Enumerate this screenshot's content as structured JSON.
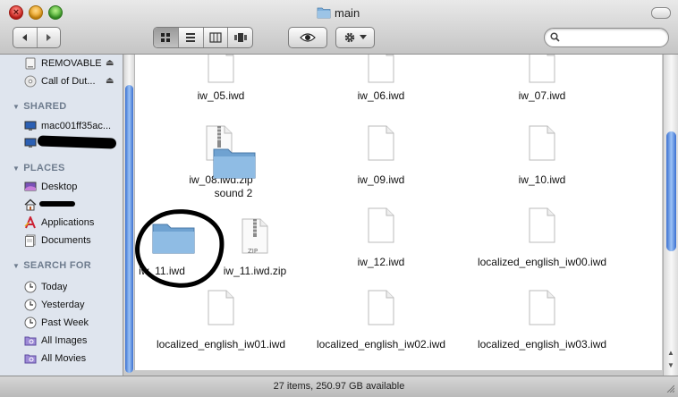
{
  "window": {
    "title": "main"
  },
  "toolbar": {
    "back_icon": "back-arrow-icon",
    "forward_icon": "forward-arrow-icon",
    "view_modes": [
      "icon-view-icon",
      "list-view-icon",
      "column-view-icon",
      "coverflow-view-icon"
    ],
    "active_view": "icon-view-icon",
    "quicklook_icon": "eye-icon",
    "action_icon": "gear-icon",
    "search": {
      "placeholder": "",
      "value": ""
    }
  },
  "sidebar": {
    "devices": [
      {
        "label": "REMOVABLE",
        "icon": "drive-icon",
        "eject": true
      },
      {
        "label": "Call of Dut...",
        "icon": "disc-icon",
        "eject": true
      }
    ],
    "shared_header": "SHARED",
    "shared": [
      {
        "label": "mac001ff35ac...",
        "icon": "monitor-icon"
      },
      {
        "label": "",
        "icon": "monitor-icon"
      }
    ],
    "places_header": "PLACES",
    "places": [
      {
        "label": "Desktop",
        "icon": "desktop-icon"
      },
      {
        "label": "",
        "icon": "home-icon"
      },
      {
        "label": "Applications",
        "icon": "applications-icon"
      },
      {
        "label": "Documents",
        "icon": "documents-icon"
      }
    ],
    "search_header": "SEARCH FOR",
    "search_for": [
      {
        "label": "Today",
        "icon": "clock-icon"
      },
      {
        "label": "Yesterday",
        "icon": "clock-icon"
      },
      {
        "label": "Past Week",
        "icon": "clock-icon"
      },
      {
        "label": "All Images",
        "icon": "smart-folder-icon"
      },
      {
        "label": "All Movies",
        "icon": "smart-folder-icon"
      }
    ]
  },
  "files": [
    {
      "label": "iw_05.iwd",
      "type": "document"
    },
    {
      "label": "iw_06.iwd",
      "type": "document"
    },
    {
      "label": "iw_07.iwd",
      "type": "document"
    },
    {
      "label": "iw_08.iwd.zip",
      "type": "zip"
    },
    {
      "label": "sound 2",
      "type": "folder"
    },
    {
      "label": "iw_09.iwd",
      "type": "document"
    },
    {
      "label": "iw_10.iwd",
      "type": "document"
    },
    {
      "label": "iw_11.iwd",
      "type": "folder"
    },
    {
      "label": "iw_11.iwd.zip",
      "type": "zip"
    },
    {
      "label": "iw_12.iwd",
      "type": "document"
    },
    {
      "label": "localized_english_iw00.iwd",
      "type": "document"
    },
    {
      "label": "localized_english_iw01.iwd",
      "type": "document"
    },
    {
      "label": "localized_english_iw02.iwd",
      "type": "document"
    },
    {
      "label": "localized_english_iw03.iwd",
      "type": "document"
    }
  ],
  "zip_badge": "ZIP",
  "status": {
    "text": "27 items, 250.97 GB available"
  },
  "colors": {
    "folder": "#7fb0dc",
    "sidebar_bg": "#dfe5ee",
    "scroll_thumb": "#3a6fd0",
    "section_header": "#6e7c8e"
  }
}
